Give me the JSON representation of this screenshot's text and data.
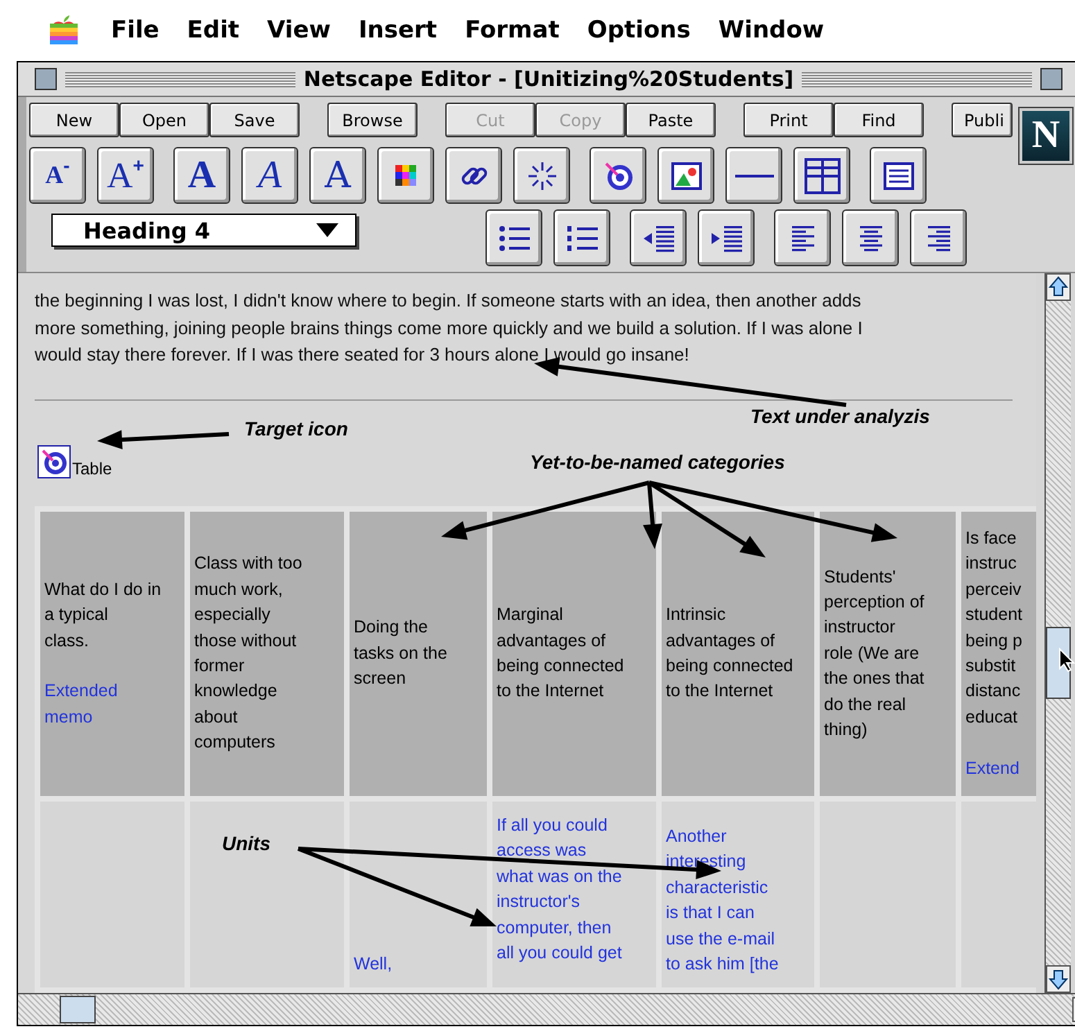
{
  "menu_bar": {
    "items": [
      "File",
      "Edit",
      "View",
      "Insert",
      "Format",
      "Options",
      "Window"
    ]
  },
  "window": {
    "title": "Netscape Editor - [Unitizing%20Students]"
  },
  "logo": "N",
  "command_toolbar": [
    [
      {
        "label": "New",
        "disabled": false
      },
      {
        "label": "Open",
        "disabled": false
      },
      {
        "label": "Save",
        "disabled": false
      }
    ],
    [
      {
        "label": "Browse",
        "disabled": false
      }
    ],
    [
      {
        "label": "Cut",
        "disabled": true
      },
      {
        "label": "Copy",
        "disabled": true
      },
      {
        "label": "Paste",
        "disabled": false
      }
    ],
    [
      {
        "label": "Print",
        "disabled": false
      },
      {
        "label": "Find",
        "disabled": false
      }
    ],
    [
      {
        "label": "Publi",
        "disabled": false
      }
    ]
  ],
  "format_toolbar": [
    [
      {
        "kind": "smaller",
        "label": "A",
        "sup": "-"
      },
      {
        "kind": "larger",
        "label": "A",
        "sup": "+"
      }
    ],
    [
      {
        "kind": "bold",
        "label": "A"
      },
      {
        "kind": "italic",
        "label": "A"
      },
      {
        "kind": "fixed",
        "label": "A"
      },
      {
        "kind": "color"
      },
      {
        "kind": "link"
      },
      {
        "kind": "sparkle"
      }
    ],
    [
      {
        "kind": "target"
      },
      {
        "kind": "image"
      },
      {
        "kind": "rule"
      },
      {
        "kind": "table"
      }
    ],
    [
      {
        "kind": "form"
      }
    ]
  ],
  "paragraph_style": "Heading 4",
  "paragraph_toolbar": [
    [
      {
        "kind": "bullets"
      },
      {
        "kind": "numbers"
      }
    ],
    [
      {
        "kind": "outdent"
      },
      {
        "kind": "indent"
      }
    ],
    [
      {
        "kind": "left"
      },
      {
        "kind": "center"
      },
      {
        "kind": "right"
      }
    ]
  ],
  "document": {
    "paragraph": "the beginning I was lost, I didn't know where to begin. If someone starts with an idea, then another adds\nmore something, joining people brains things come more quickly and we build a solution. If I was alone I\nwould stay there forever. If I was there seated for 3 hours alone I would go insane!",
    "target_label": "Table",
    "table": {
      "header": [
        {
          "text": "What do I do in\na typical\nclass.",
          "link": "Extended\nmemo"
        },
        {
          "text": "Class with too\nmuch work,\nespecially\nthose without\nformer\nknowledge\nabout\ncomputers"
        },
        {
          "text": "Doing the\ntasks on the\nscreen"
        },
        {
          "text": "Marginal\nadvantages of\nbeing connected\nto the Internet"
        },
        {
          "text": "Intrinsic\nadvantages of\nbeing connected\nto the Internet"
        },
        {
          "text": "Students'\nperception of\ninstructor\nrole (We are\nthe ones that\ndo the real\nthing)"
        },
        {
          "text": "Is face\ninstruc\nperceiv\nstudent\nbeing p\nsubstit\ndistanc\neducat",
          "link": "Extend"
        }
      ],
      "row": [
        {
          "kind": "empty"
        },
        {
          "kind": "empty"
        },
        {
          "kind": "unit",
          "text": "Well,"
        },
        {
          "kind": "unit",
          "text": "If all you could\naccess was\nwhat was on the\ninstructor's\ncomputer, then\nall you could get"
        },
        {
          "kind": "unit",
          "text": "Another\ninteresting\ncharacteristic\nis that I can\nuse the e-mail\nto ask him [the"
        },
        {
          "kind": "empty"
        },
        {
          "kind": "empty"
        }
      ]
    }
  },
  "annotations": [
    {
      "text": "Text under analyzis"
    },
    {
      "text": "Target icon"
    },
    {
      "text": "Yet-to-be-named categories"
    },
    {
      "text": "Units"
    }
  ]
}
